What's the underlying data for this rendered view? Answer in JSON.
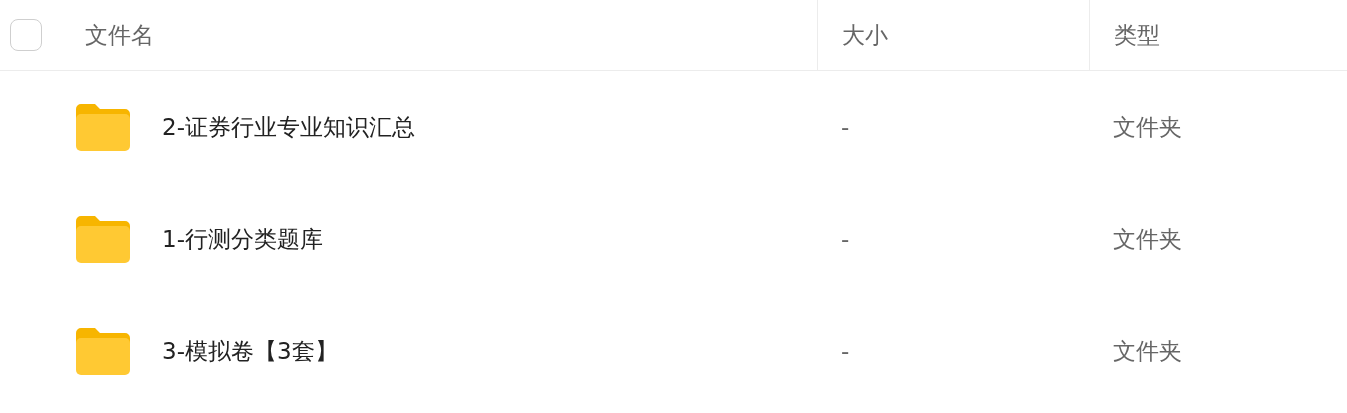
{
  "table": {
    "select_all": {
      "checked": false
    },
    "columns": [
      "文件名",
      "大小",
      "类型"
    ],
    "rows": [
      {
        "name": "2-证券行业专业知识汇总",
        "size": "-",
        "type": "文件夹"
      },
      {
        "name": "1-行测分类题库",
        "size": "-",
        "type": "文件夹"
      },
      {
        "name": "3-模拟卷【3套】",
        "size": "-",
        "type": "文件夹"
      }
    ]
  }
}
